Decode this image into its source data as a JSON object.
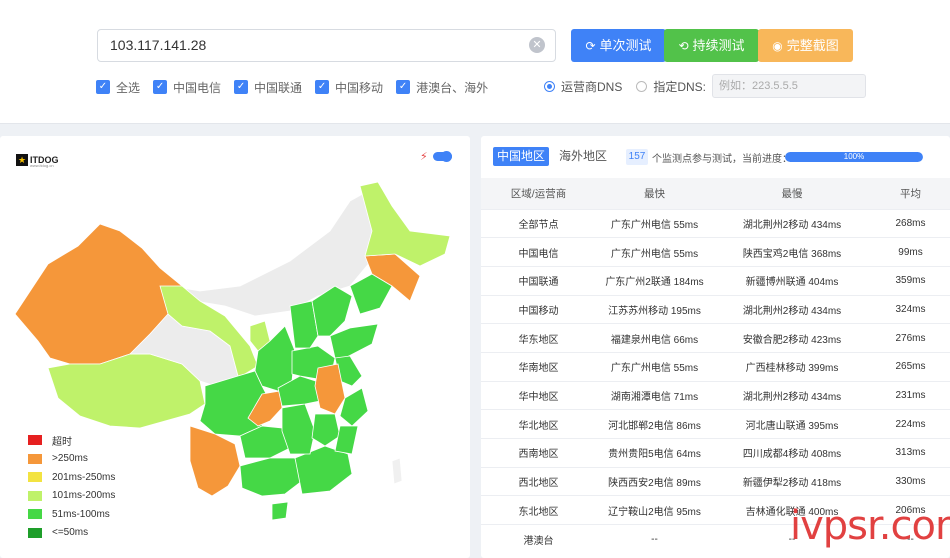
{
  "top": {
    "ip_value": "103.117.141.28",
    "buttons": {
      "single": "单次测试",
      "continuous": "持续测试",
      "screenshot": "完整截图"
    },
    "checkboxes": [
      "全选",
      "中国电信",
      "中国联通",
      "中国移动",
      "港澳台、海外"
    ],
    "dns": {
      "operator_label": "运营商DNS",
      "custom_label": "指定DNS:",
      "placeholder": "例如：223.5.5.5",
      "selected": "运营商DNS"
    }
  },
  "map": {
    "logo_text": "ITDOG",
    "logo_sub": "www.itdog.cn",
    "legend": [
      {
        "label": "超时",
        "color": "#e62020"
      },
      {
        "label": ">250ms",
        "color": "#f5973a"
      },
      {
        "label": "201ms-250ms",
        "color": "#f3e341"
      },
      {
        "label": "101ms-200ms",
        "color": "#bff26a"
      },
      {
        "label": "51ms-100ms",
        "color": "#45d846"
      },
      {
        "label": "<=50ms",
        "color": "#1e9e2a"
      }
    ]
  },
  "results": {
    "tabs": [
      "中国地区",
      "海外地区"
    ],
    "active_tab": "中国地区",
    "node_count": "157",
    "count_text": "个监测点参与测试，当前进度：",
    "progress_label": "100%",
    "progress": 1.0,
    "headers": [
      "区域/运营商",
      "最快",
      "最慢",
      "平均"
    ],
    "rows": [
      [
        "全部节点",
        "广东广州电信 55ms",
        "湖北荆州2移动 434ms",
        "268ms"
      ],
      [
        "中国电信",
        "广东广州电信 55ms",
        "陕西宝鸡2电信 368ms",
        "99ms"
      ],
      [
        "中国联通",
        "广东广州2联通 184ms",
        "新疆博州联通 404ms",
        "359ms"
      ],
      [
        "中国移动",
        "江苏苏州移动 195ms",
        "湖北荆州2移动 434ms",
        "324ms"
      ],
      [
        "华东地区",
        "福建泉州电信 66ms",
        "安徽合肥2移动 423ms",
        "276ms"
      ],
      [
        "华南地区",
        "广东广州电信 55ms",
        "广西桂林移动 399ms",
        "265ms"
      ],
      [
        "华中地区",
        "湖南湘潭电信 71ms",
        "湖北荆州2移动 434ms",
        "231ms"
      ],
      [
        "华北地区",
        "河北邯郸2电信 86ms",
        "河北唐山联通 395ms",
        "224ms"
      ],
      [
        "西南地区",
        "贵州贵阳5电信 64ms",
        "四川成都4移动 408ms",
        "313ms"
      ],
      [
        "西北地区",
        "陕西西安2电信 89ms",
        "新疆伊犁2移动 418ms",
        "330ms"
      ],
      [
        "东北地区",
        "辽宁鞍山2电信 95ms",
        "吉林通化联通 400ms",
        "206ms"
      ],
      [
        "港澳台",
        "--",
        "--",
        "--"
      ]
    ]
  },
  "watermark": "ivpsr.com",
  "colors": {
    "accent": "#3f82f7",
    "green": "#52c24a",
    "orange": "#f8b75a"
  }
}
